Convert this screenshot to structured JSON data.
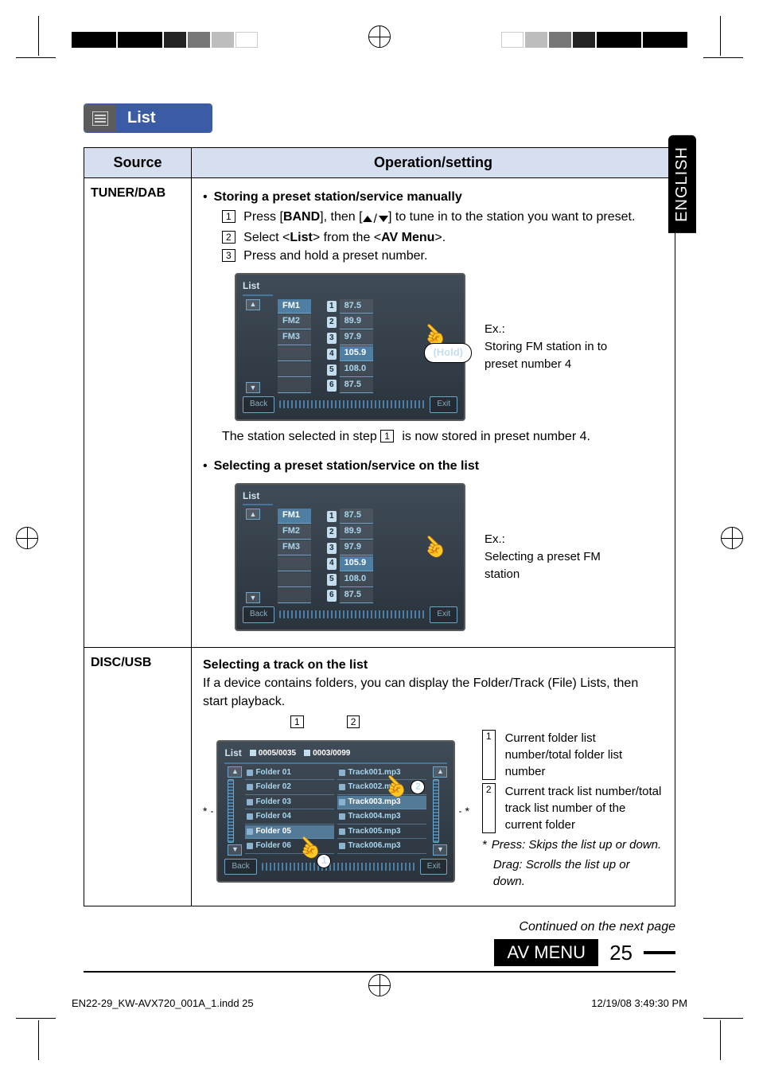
{
  "domain": "Document",
  "header": {
    "tab_icon": "list-icon",
    "tab_label": "List"
  },
  "language_tab": "ENGLISH",
  "table": {
    "headers": {
      "source": "Source",
      "operation": "Operation/setting"
    },
    "rows": {
      "tuner": {
        "source": "TUNER/DAB",
        "section1_title": "Storing a preset station/service manually",
        "step1_pre": "Press [",
        "step1_band": "BAND",
        "step1_mid1": "], then [",
        "step1_mid2": " / ",
        "step1_end": "] to tune in to the station you want to preset.",
        "step2_pre": "Select <",
        "step2_list": "List",
        "step2_mid": "> from the <",
        "step2_av": "AV Menu",
        "step2_end": ">.",
        "step3": "Press and hold a preset number.",
        "screenshot1": {
          "title": "List",
          "bands": [
            "FM1",
            "FM2",
            "FM3"
          ],
          "presets": [
            {
              "n": "1",
              "freq": "87.5"
            },
            {
              "n": "2",
              "freq": "89.9"
            },
            {
              "n": "3",
              "freq": "97.9"
            },
            {
              "n": "4",
              "freq": "105.9"
            },
            {
              "n": "5",
              "freq": "108.0"
            },
            {
              "n": "6",
              "freq": "87.5"
            }
          ],
          "back": "Back",
          "exit": "Exit",
          "hold": "(Hold)"
        },
        "ex1_label": "Ex.:",
        "ex1_text": "Storing FM station in to preset number 4",
        "after_step_pre": "The station selected in step ",
        "after_step_n": "1",
        "after_step_post": " is now stored in preset number 4.",
        "section2_title": "Selecting a preset station/service on the list",
        "screenshot2": {
          "title": "List",
          "bands": [
            "FM1",
            "FM2",
            "FM3"
          ],
          "presets": [
            {
              "n": "1",
              "freq": "87.5"
            },
            {
              "n": "2",
              "freq": "89.9"
            },
            {
              "n": "3",
              "freq": "97.9"
            },
            {
              "n": "4",
              "freq": "105.9"
            },
            {
              "n": "5",
              "freq": "108.0"
            },
            {
              "n": "6",
              "freq": "87.5"
            }
          ],
          "back": "Back",
          "exit": "Exit"
        },
        "ex2_label": "Ex.:",
        "ex2_text": "Selecting a preset FM station"
      },
      "disc": {
        "source": "DISC/USB",
        "title": "Selecting a track on the list",
        "lead": "If a device contains folders, you can display the Folder/Track (File) Lists, then start playback.",
        "callout1": "1",
        "callout2": "2",
        "screenshot": {
          "title": "List",
          "folder_counter": "0005/0035",
          "track_counter": "0003/0099",
          "folders": [
            "Folder 01",
            "Folder 02",
            "Folder 03",
            "Folder 04",
            "Folder 05",
            "Folder 06"
          ],
          "tracks": [
            "Track001.mp3",
            "Track002.mp3",
            "Track003.mp3",
            "Track004.mp3",
            "Track005.mp3",
            "Track006.mp3"
          ],
          "back": "Back",
          "exit": "Exit"
        },
        "star_left": "*",
        "star_right": "*",
        "circled1": "1",
        "circled2": "2",
        "notes": {
          "n1": "Current folder list number/total folder list number",
          "n2": "Current track list number/total track list number of the current folder",
          "star_label": "*",
          "star_a": "Press: Skips the list up or down.",
          "star_b": "Drag: Scrolls the list up or down."
        }
      }
    }
  },
  "footer": {
    "continued": "Continued on the next page",
    "av_menu": "AV MENU",
    "page_no": "25"
  },
  "print": {
    "file": "EN22-29_KW-AVX720_001A_1.indd   25",
    "timestamp": "12/19/08   3:49:30 PM"
  }
}
